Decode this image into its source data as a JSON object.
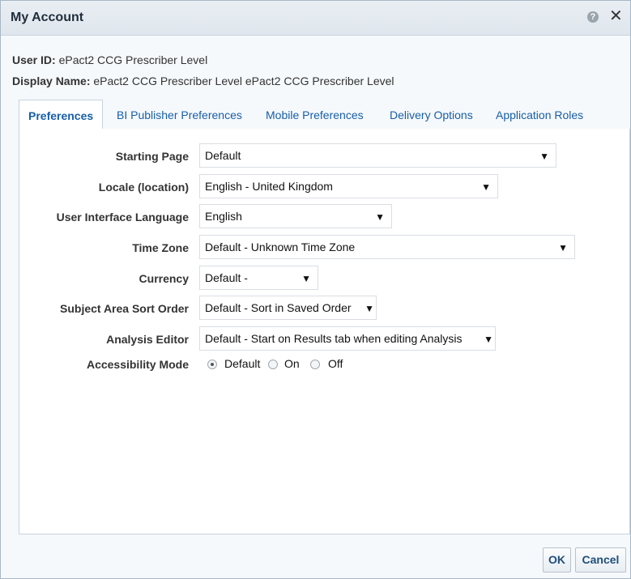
{
  "dialog": {
    "title": "My Account"
  },
  "user": {
    "id_label": "User ID:",
    "id_value": "ePact2 CCG Prescriber Level",
    "display_label": "Display Name:",
    "display_value": "ePact2 CCG Prescriber Level ePact2 CCG Prescriber Level"
  },
  "tabs": [
    {
      "label": "Preferences",
      "active": true
    },
    {
      "label": "BI Publisher Preferences"
    },
    {
      "label": "Mobile Preferences"
    },
    {
      "label": "Delivery Options"
    },
    {
      "label": "Application Roles"
    }
  ],
  "fields": {
    "starting_page": {
      "label": "Starting Page",
      "value": "Default"
    },
    "locale": {
      "label": "Locale (location)",
      "value": "English - United Kingdom"
    },
    "ui_language": {
      "label": "User Interface Language",
      "value": "English"
    },
    "time_zone": {
      "label": "Time Zone",
      "value": "Default - Unknown Time Zone"
    },
    "currency": {
      "label": "Currency",
      "value": "Default -"
    },
    "sort_order": {
      "label": "Subject Area Sort Order",
      "value": "Default - Sort in Saved Order"
    },
    "analysis_editor": {
      "label": "Analysis Editor",
      "value": "Default - Start on Results tab when editing Analysis"
    },
    "accessibility": {
      "label": "Accessibility Mode",
      "options": [
        "Default",
        "On",
        "Off"
      ],
      "selected": "Default"
    }
  },
  "buttons": {
    "ok": "OK",
    "cancel": "Cancel"
  },
  "icons": {
    "help": "help-icon",
    "close": "close-icon",
    "dropdown": "caret-down-icon"
  }
}
